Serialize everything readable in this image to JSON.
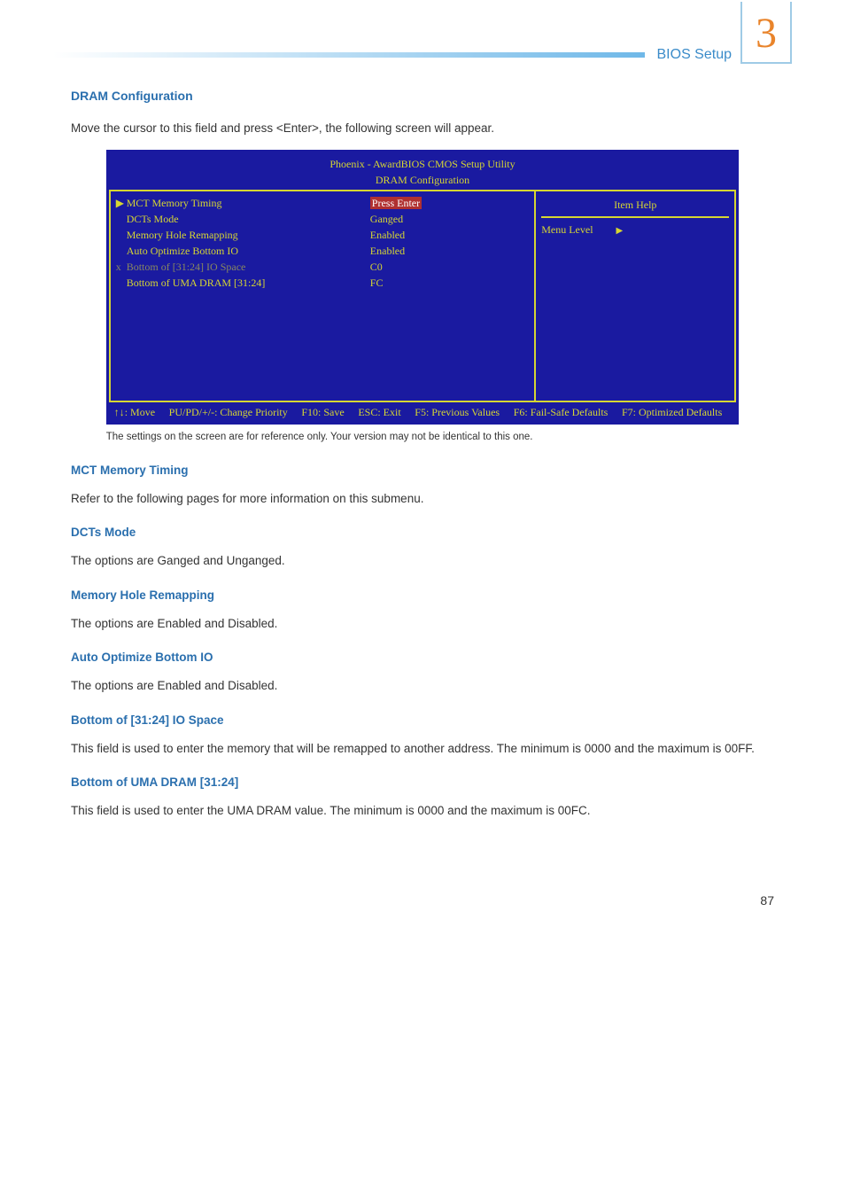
{
  "header": {
    "section": "BIOS Setup",
    "chapter_number": "3"
  },
  "dram": {
    "title": "DRAM Configuration",
    "intro": "Move the cursor to this field and press <Enter>, the following screen will appear."
  },
  "bios": {
    "title_line1": "Phoenix - AwardBIOS CMOS Setup Utility",
    "title_line2": "DRAM Configuration",
    "rows": [
      {
        "prefix": "▶",
        "label": "MCT Memory Timing",
        "value": "Press Enter",
        "highlight": true
      },
      {
        "prefix": "",
        "label": "DCTs Mode",
        "value": "Ganged"
      },
      {
        "prefix": "",
        "label": "Memory Hole Remapping",
        "value": "Enabled"
      },
      {
        "prefix": "",
        "label": "Auto Optimize Bottom IO",
        "value": "Enabled"
      },
      {
        "prefix": "x",
        "label": "Bottom of [31:24] IO Space",
        "value": "C0"
      },
      {
        "prefix": "",
        "label": "Bottom of UMA DRAM [31:24]",
        "value": "FC"
      }
    ],
    "help_title": "Item Help",
    "help_body": "Menu Level",
    "footer": {
      "move": "↑↓: Move",
      "change": "PU/PD/+/-: Change Priority",
      "save": "F10: Save",
      "exit": "ESC: Exit",
      "f5": "F5: Previous Values",
      "f6": "F6: Fail-Safe Defaults",
      "f7": "F7: Optimized Defaults"
    },
    "caption": "The settings on the screen are for reference only. Your version may not be identical to this one."
  },
  "sections": {
    "mct": {
      "title": "MCT Memory Timing",
      "body": "Refer to the following pages for more information on this submenu."
    },
    "dcts": {
      "title": "DCTs Mode",
      "body": "The options are Ganged and Unganged."
    },
    "mem": {
      "title": "Memory Hole Remapping",
      "body": "The options are Enabled and Disabled."
    },
    "auto": {
      "title": "Auto Optimize Bottom IO",
      "body": "The options are Enabled and Disabled."
    },
    "b31": {
      "title": "Bottom of [31:24] IO Space",
      "body": "This field is used to enter the memory that will be remapped to another address. The minimum is 0000 and the maximum is 00FF."
    },
    "buma": {
      "title": "Bottom of UMA DRAM [31:24]",
      "body": "This field is used to enter the UMA DRAM value. The minimum is 0000 and the maximum is 00FC."
    }
  },
  "page_number": "87"
}
